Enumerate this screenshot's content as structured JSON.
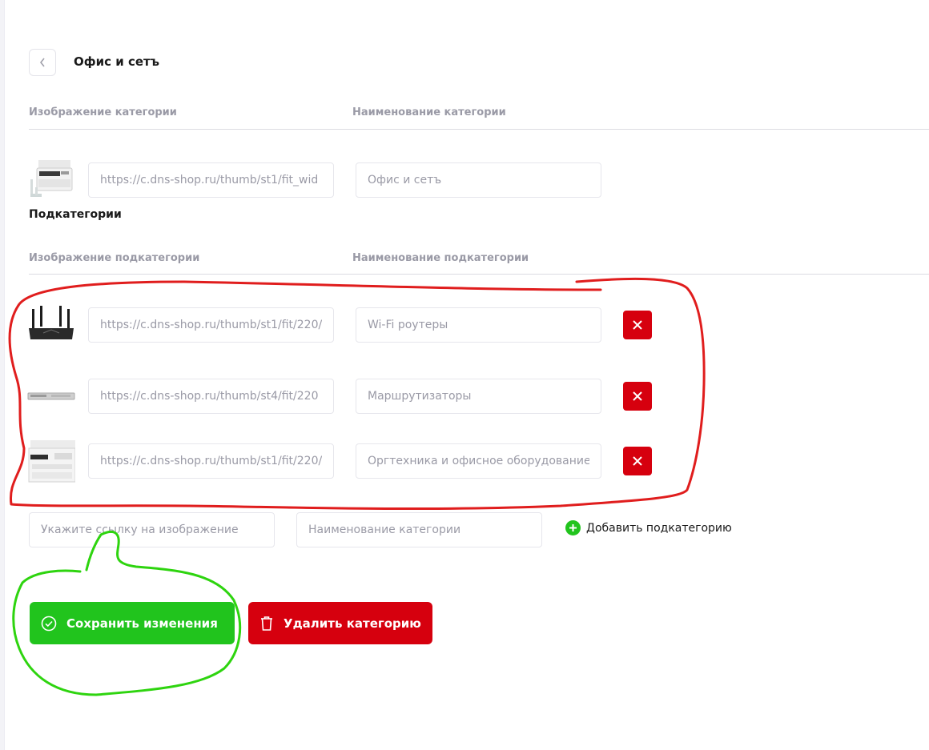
{
  "header": {
    "title": "Офис и сетъ"
  },
  "category": {
    "image_header": "Изображение категории",
    "name_header": "Наименование категории",
    "image_url": "https://c.dns-shop.ru/thumb/st1/fit_wid",
    "name": "Офис и сетъ"
  },
  "subcategories": {
    "title": "Подкатегории",
    "image_header": "Изображение подкатегории",
    "name_header": "Наименование подкатегории",
    "items": [
      {
        "image_url": "https://c.dns-shop.ru/thumb/st1/fit/220/",
        "name": "Wi-Fi роутеры",
        "thumb_icon": "wifi-router"
      },
      {
        "image_url": "https://c.dns-shop.ru/thumb/st4/fit/220",
        "name": "Маршрутизаторы",
        "thumb_icon": "rack-router"
      },
      {
        "image_url": "https://c.dns-shop.ru/thumb/st1/fit/220/",
        "name": "Оргтехника и офисное оборудование",
        "thumb_icon": "office-printer"
      }
    ],
    "new_item": {
      "image_placeholder": "Укажите ссылку на изображение",
      "name_placeholder": "Наименование категории"
    },
    "add_label": "Добавить подкатегорию"
  },
  "actions": {
    "save_label": "Сохранить изменения",
    "delete_label": "Удалить категорию"
  },
  "colors": {
    "save": "#21c41d",
    "danger": "#d6000e",
    "annotation_red": "#e01d1d",
    "annotation_green": "#2ed40f"
  }
}
